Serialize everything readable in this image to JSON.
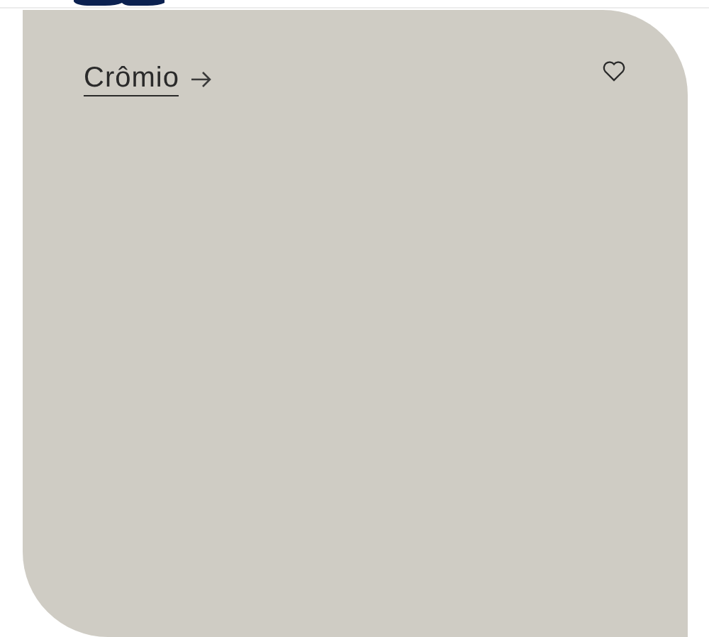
{
  "swatch": {
    "name": "Crômio",
    "color": "#cfccc4",
    "favorite": false
  }
}
